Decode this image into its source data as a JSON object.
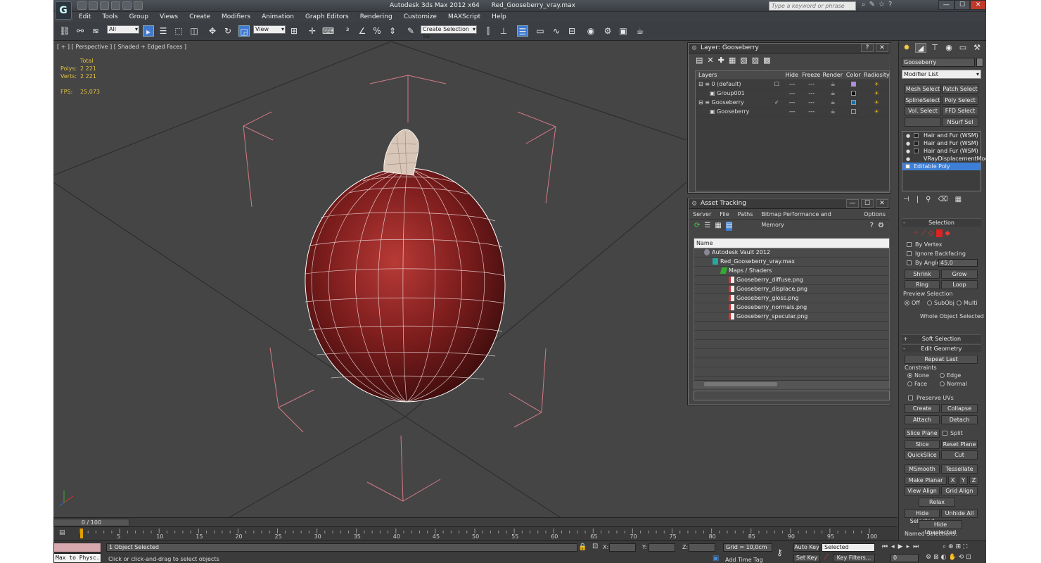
{
  "window": {
    "app_title": "Autodesk 3ds Max  2012 x64",
    "file_name": "Red_Gooseberry_vray.max",
    "search_placeholder": "Type a keyword or phrase",
    "logo_letter": "G"
  },
  "menu": [
    "Edit",
    "Tools",
    "Group",
    "Views",
    "Create",
    "Modifiers",
    "Animation",
    "Graph Editors",
    "Rendering",
    "Customize",
    "MAXScript",
    "Help"
  ],
  "toolbar": {
    "selection_filter": "All",
    "ref_coord": "View",
    "named_selection": "Create Selection Se"
  },
  "viewport": {
    "label": "[ + ] [ Perspective ] [ Shaded + Edged Faces ]",
    "stats_header": "Total",
    "polys_label": "Polys:",
    "polys_value": "2 221",
    "verts_label": "Verts:",
    "verts_value": "2 221",
    "fps_label": "FPS:",
    "fps_value": "25,073",
    "object_color": "#8a1f1f"
  },
  "layer_panel": {
    "title": "Layer: Gooseberry",
    "help": "?",
    "close": "✕",
    "columns": [
      "Layers",
      "Hide",
      "Freeze",
      "Render",
      "Color",
      "Radiosity"
    ],
    "rows": [
      {
        "name": "0 (default)",
        "indent": 0,
        "color": "#b28fe6",
        "current": "☐"
      },
      {
        "name": "Group001",
        "indent": 1,
        "color": "#111111",
        "current": ""
      },
      {
        "name": "Gooseberry",
        "indent": 0,
        "color": "#1a6fa0",
        "current": "✓"
      },
      {
        "name": "Gooseberry",
        "indent": 1,
        "color": "#3d3d3d",
        "current": ""
      }
    ]
  },
  "asset_panel": {
    "title": "Asset Tracking",
    "menu": [
      "Server",
      "File",
      "Paths",
      "Bitmap Performance and Memory",
      "Options"
    ],
    "column": "Name",
    "rows": [
      {
        "text": "Autodesk Vault 2012",
        "indent": 1,
        "icon": "vault-icon"
      },
      {
        "text": "Red_Gooseberry_vray.max",
        "indent": 2,
        "icon": "max-file-icon"
      },
      {
        "text": "Maps / Shaders",
        "indent": 3,
        "icon": "maps-icon"
      },
      {
        "text": "Gooseberry_diffuse.png",
        "indent": 4,
        "icon": "image-file-icon"
      },
      {
        "text": "Gooseberry_displace.png",
        "indent": 4,
        "icon": "image-file-icon"
      },
      {
        "text": "Gooseberry_gloss.png",
        "indent": 4,
        "icon": "image-file-icon"
      },
      {
        "text": "Gooseberry_normals.png",
        "indent": 4,
        "icon": "image-file-icon"
      },
      {
        "text": "Gooseberry_specular.png",
        "indent": 4,
        "icon": "image-file-icon"
      }
    ],
    "min": "—",
    "max": "☐",
    "close": "✕"
  },
  "command_panel": {
    "object_name": "Gooseberry",
    "modifier_list": "Modifier List",
    "mod_buttons": [
      "Mesh Select",
      "Patch Select",
      "SplineSelect",
      "Poly Select",
      "Vol. Select",
      "FFD Select",
      "NSurf Sel"
    ],
    "stack": [
      {
        "name": "Hair and Fur (WSM)",
        "selected": false
      },
      {
        "name": "Hair and Fur (WSM)",
        "selected": false
      },
      {
        "name": "Hair and Fur (WSM)",
        "selected": false
      },
      {
        "name": "VRayDisplacementMod",
        "selected": false
      },
      {
        "name": "Editable Poly",
        "selected": true
      }
    ],
    "selection_title": "Selection",
    "by_vertex": "By Vertex",
    "ignore_backfacing": "Ignore Backfacing",
    "by_angle": "By Angle:",
    "angle_value": "45,0",
    "shrink": "Shrink",
    "grow": "Grow",
    "ring": "Ring",
    "loop": "Loop",
    "preview_title": "Preview Selection",
    "preview_off": "Off",
    "preview_subobj": "SubObj",
    "preview_multi": "Multi",
    "whole_object": "Whole Object Selected",
    "soft_selection": "Soft Selection",
    "edit_geometry": "Edit Geometry",
    "repeat_last": "Repeat Last",
    "constraints": "Constraints",
    "c_none": "None",
    "c_edge": "Edge",
    "c_face": "Face",
    "c_normal": "Normal",
    "preserve_uvs": "Preserve UVs",
    "create": "Create",
    "collapse": "Collapse",
    "attach": "Attach",
    "detach": "Detach",
    "slice_plane": "Slice Plane",
    "split": "Split",
    "slice": "Slice",
    "reset_plane": "Reset Plane",
    "quickslice": "QuickSlice",
    "cut": "Cut",
    "msmooth": "MSmooth",
    "tessellate": "Tessellate",
    "make_planar": "Make Planar",
    "x": "X",
    "y": "Y",
    "z": "Z",
    "view_align": "View Align",
    "grid_align": "Grid Align",
    "relax": "Relax",
    "hide_selected": "Hide Selected",
    "unhide_all": "Unhide All",
    "hide_unselected": "Hide Unselected",
    "named_selections": "Named Selections:"
  },
  "timeline": {
    "frame_label": "0 / 100",
    "ticks": [
      "5",
      "10",
      "15",
      "20",
      "25",
      "30",
      "35",
      "40",
      "45",
      "50",
      "55",
      "60",
      "65",
      "70",
      "75",
      "80",
      "85",
      "90",
      "95",
      "100"
    ]
  },
  "status": {
    "listener_text": "Max to Physc.",
    "selected": "1 Object Selected",
    "prompt": "Click or click-and-drag to select objects",
    "x_label": "X:",
    "y_label": "Y:",
    "z_label": "Z:",
    "grid": "Grid = 10,0cm",
    "add_time_tag": "Add Time Tag",
    "auto_key": "Auto Key",
    "set_key": "Set Key",
    "key_mode": "Selected",
    "key_filters": "Key Filters...",
    "current_frame": "0"
  }
}
